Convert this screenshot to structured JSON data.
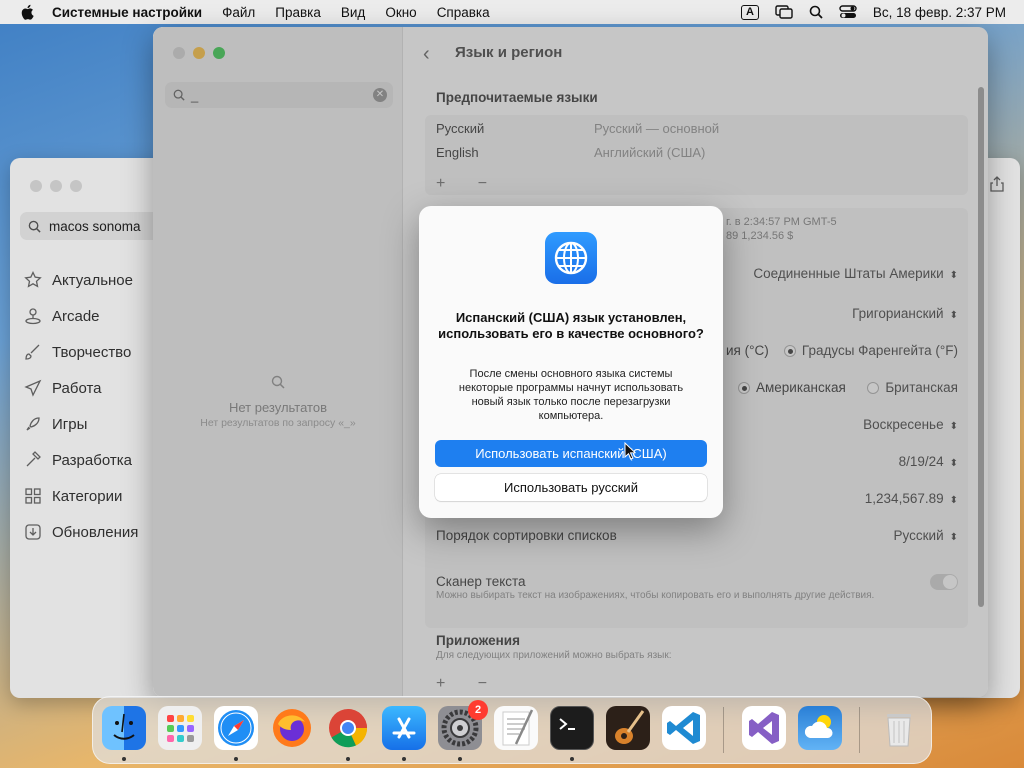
{
  "menubar": {
    "app_name": "Системные настройки",
    "items": [
      "Файл",
      "Правка",
      "Вид",
      "Окно",
      "Справка"
    ],
    "input_indicator": "A",
    "datetime": "Вс, 18 февр.  2:37 PM"
  },
  "store": {
    "search_value": "macos sonoma",
    "nav": [
      {
        "label": "Актуальное",
        "icon": "star-icon"
      },
      {
        "label": "Arcade",
        "icon": "joystick-icon"
      },
      {
        "label": "Творчество",
        "icon": "brush-icon"
      },
      {
        "label": "Работа",
        "icon": "paperplane-icon"
      },
      {
        "label": "Игры",
        "icon": "rocket-icon"
      },
      {
        "label": "Разработка",
        "icon": "hammer-icon"
      },
      {
        "label": "Категории",
        "icon": "grid-icon"
      },
      {
        "label": "Обновления",
        "icon": "download-icon"
      }
    ]
  },
  "settings": {
    "search_value": "_",
    "no_results_title": "Нет результатов",
    "no_results_subtitle": "Нет результатов по запросу «_»",
    "title": "Язык и регион",
    "preferred_languages_title": "Предпочитаемые языки",
    "languages": [
      {
        "name": "Русский",
        "desc": "Русский — основной"
      },
      {
        "name": "English",
        "desc": "Английский (США)"
      }
    ],
    "preview_line1": "г. в 2:34:57 PM GMT-5",
    "preview_line2": "89     1,234.56 $",
    "region_value": "Соединенные Штаты Америки",
    "calendar_value": "Григорианский",
    "temp_celsius": "ия (°C)",
    "temp_fahrenheit": "Градусы Фаренгейта (°F)",
    "measure_us": "Американская",
    "measure_uk": "Британская",
    "first_day_value": "Воскресенье",
    "date_format_value": "8/19/24",
    "number_format_value": "1,234,567.89",
    "sort_order_label": "Порядок сортировки списков",
    "sort_order_value": "Русский",
    "live_text_label": "Сканер текста",
    "live_text_note": "Можно выбирать текст на изображениях, чтобы копировать его и выполнять другие действия.",
    "apps_title": "Приложения",
    "apps_note": "Для следующих приложений можно выбрать язык:"
  },
  "alert": {
    "icon": "globe-icon",
    "title": "Испанский (США) язык установлен, использовать его в качестве основного?",
    "body": "После смены основного языка системы некоторые программы начнут использовать новый язык только после перезагрузки компьютера.",
    "primary_button": "Использовать испанский (США)",
    "secondary_button": "Использовать русский"
  },
  "dock": {
    "items": [
      {
        "name": "finder-icon",
        "color": "#2f8df0"
      },
      {
        "name": "launchpad-icon",
        "color": "#e8e8e8"
      },
      {
        "name": "safari-icon",
        "color": "#1f8ef5"
      },
      {
        "name": "firefox-icon",
        "color": "#e65a1e"
      },
      {
        "name": "chrome-icon",
        "color": "#ffffff"
      },
      {
        "name": "app-store-icon",
        "color": "#1d8cf0"
      },
      {
        "name": "system-settings-icon",
        "color": "#8e8e93",
        "badge": "2"
      },
      {
        "name": "textedit-icon",
        "color": "#f2f2f2"
      },
      {
        "name": "terminal-icon",
        "color": "#1c1c1c"
      },
      {
        "name": "garageband-icon",
        "color": "#3b2a1d"
      },
      {
        "name": "vscode-icon",
        "color": "#ffffff"
      },
      {
        "name": "visual-studio-icon",
        "color": "#ffffff"
      },
      {
        "name": "weather-icon",
        "color": "#2a7fd6"
      },
      {
        "name": "trash-icon",
        "color": "#e6e6e6"
      }
    ]
  }
}
